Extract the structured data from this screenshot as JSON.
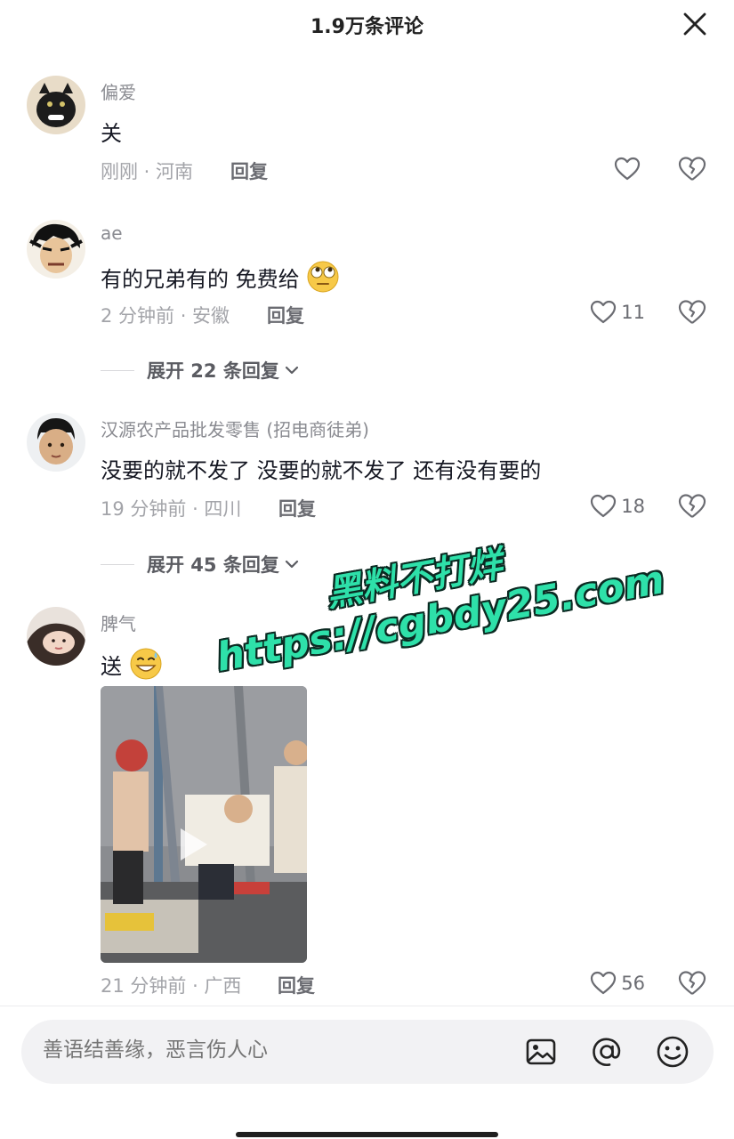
{
  "header": {
    "title": "1.9万条评论"
  },
  "comments": [
    {
      "username": "偏爱",
      "text": "关",
      "time_location": "刚刚 · 河南",
      "reply": "回复",
      "likes": ""
    },
    {
      "username": "ae",
      "text": "有的兄弟有的  免费给",
      "time_location": "2 分钟前 · 安徽",
      "reply": "回复",
      "likes": "11",
      "expand": "展开 22 条回复"
    },
    {
      "username": "汉源农产品批发零售 (招电商徒弟)",
      "text": "没要的就不发了 没要的就不发了 还有没有要的",
      "time_location": "19 分钟前 · 四川",
      "reply": "回复",
      "likes": "18",
      "expand": "展开 45 条回复"
    },
    {
      "username": "脾气",
      "text": "送",
      "time_location": "21 分钟前 · 广西",
      "reply": "回复",
      "likes": "56"
    }
  ],
  "watermark": {
    "line1": "黑料不打烊",
    "line2": "https://cgbdy25.com"
  },
  "input": {
    "placeholder": "善语结善缘，恶言伤人心"
  },
  "icons": {
    "close": "close-icon",
    "like": "heart-outline-icon",
    "dislike": "broken-heart-icon",
    "image": "image-icon",
    "mention": "at-icon",
    "emoji": "smiley-icon"
  }
}
